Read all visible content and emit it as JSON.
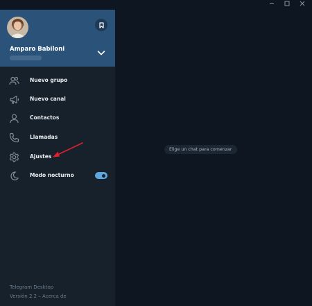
{
  "window": {
    "minimize_icon": "minimize-icon",
    "maximize_icon": "maximize-icon",
    "close_icon": "close-icon"
  },
  "profile": {
    "name": "Amparo Babiloni",
    "phone_blurred": true
  },
  "menu": {
    "items": [
      {
        "label": "Nuevo grupo",
        "icon": "group-icon"
      },
      {
        "label": "Nuevo canal",
        "icon": "megaphone-icon"
      },
      {
        "label": "Contactos",
        "icon": "person-icon"
      },
      {
        "label": "Llamadas",
        "icon": "phone-icon"
      },
      {
        "label": "Ajustes",
        "icon": "gear-icon"
      },
      {
        "label": "Modo nocturno",
        "icon": "moon-icon",
        "toggle_on": true
      }
    ]
  },
  "footer": {
    "app_name": "Telegram Desktop",
    "version": "Versión 2.2 – Acerca de"
  },
  "chat": {
    "empty_message": "Elige un chat para comenzar"
  },
  "colors": {
    "header_bg": "#2b5278",
    "drawer_bg": "#17212b",
    "chat_bg": "#0e1621",
    "toggle_accent": "#5fa6de",
    "annotation_arrow": "#e0202a"
  }
}
